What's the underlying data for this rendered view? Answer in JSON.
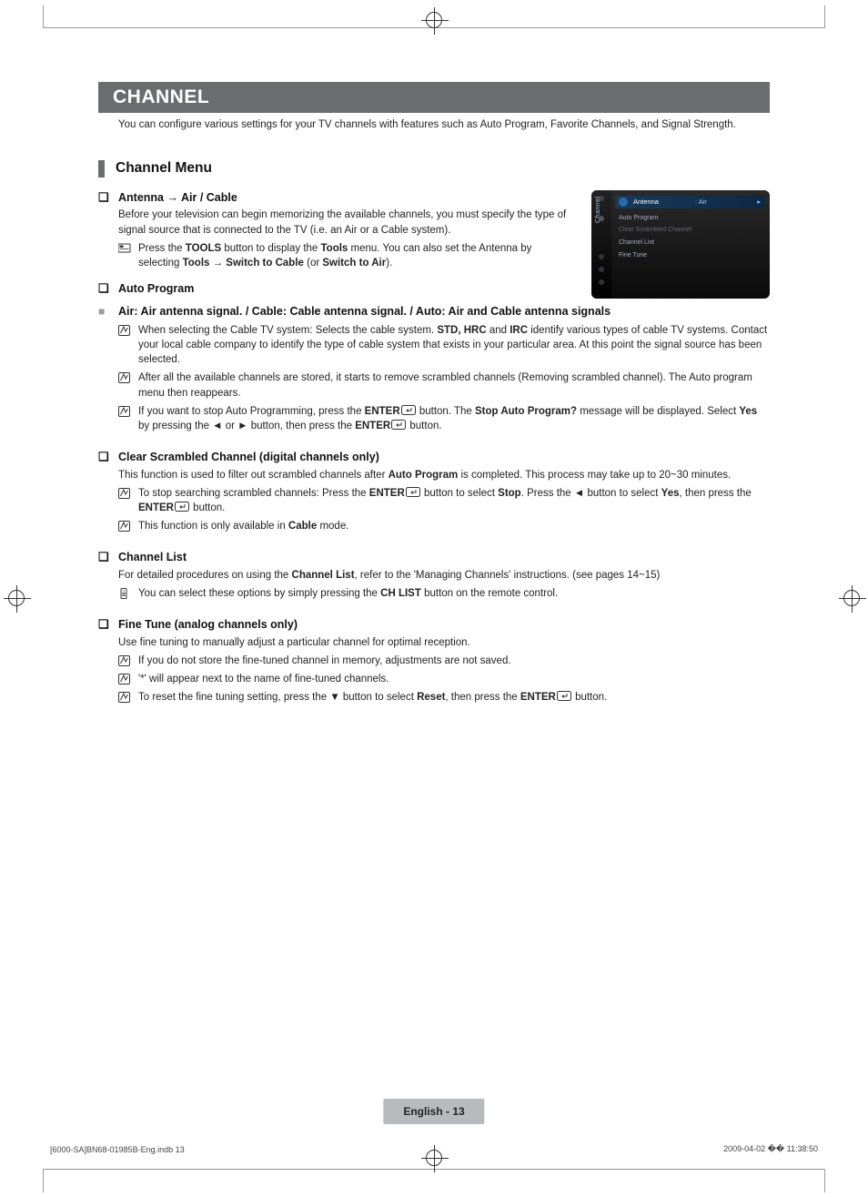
{
  "title": "CHANNEL",
  "intro": "You can configure various settings for your TV channels with features such as Auto Program, Favorite Channels, and Signal Strength.",
  "h2": "Channel Menu",
  "antenna": {
    "head_pre": "Antenna → ",
    "head_b": "Air / Cable",
    "body": "Before your television can begin memorizing the available channels, you must specify the type of signal source that is connected to the TV (i.e. an Air or a Cable system).",
    "tool_pre": "Press the ",
    "tool_b1": "TOOLS",
    "tool_mid": " button to display the ",
    "tool_b2": "Tools",
    "tool_mid2": " menu. You can also set the Antenna by selecting ",
    "tool_b3": "Tools → Switch to Cable",
    "tool_mid3": " (or ",
    "tool_b4": "Switch to Air",
    "tool_end": ")."
  },
  "autoprog": {
    "head": "Auto Program",
    "sig": "Air: Air antenna signal. / Cable: Cable antenna signal. / Auto: Air and Cable antenna signals",
    "n1_pre": "When selecting the Cable TV system: Selects the cable system. ",
    "n1_b1": "STD, HRC",
    "n1_mid": " and ",
    "n1_b2": "IRC",
    "n1_post": " identify various types of cable TV systems. Contact your local cable company to identify the type of cable system that exists in your particular area. At this point the signal source has been selected.",
    "n2": "After all the available channels are stored, it starts to remove scrambled channels (Removing scrambled channel). The Auto program menu then reappears.",
    "n3_pre": "If you want to stop Auto Programming, press the ",
    "n3_b1": "ENTER",
    "n3_mid": " button. The ",
    "n3_b2": "Stop Auto Program?",
    "n3_mid2": " message will be displayed. Select ",
    "n3_b3": "Yes",
    "n3_mid3": " by pressing the ◄ or ► button, then press the ",
    "n3_b4": "ENTER",
    "n3_end": " button."
  },
  "clear": {
    "head": "Clear Scrambled Channel (digital channels only)",
    "body_pre": "This function is used to filter out scrambled channels after ",
    "body_b": "Auto Program",
    "body_post": " is completed. This process may take up to 20~30 minutes.",
    "n1_pre": "To stop searching scrambled channels: Press the ",
    "n1_b1": "ENTER",
    "n1_mid": " button to select ",
    "n1_b2": "Stop",
    "n1_mid2": ". Press the ◄ button to select ",
    "n1_b3": "Yes",
    "n1_mid3": ", then press the ",
    "n1_b4": "ENTER",
    "n1_end": " button.",
    "n2_pre": "This function is only available in ",
    "n2_b": "Cable",
    "n2_post": " mode."
  },
  "chlist": {
    "head": "Channel List",
    "body_pre": "For detailed procedures on using the ",
    "body_b": "Channel List",
    "body_post": ", refer to the 'Managing Channels' instructions. (see pages 14~15)",
    "r_pre": "You can select these options by simply pressing the ",
    "r_b": "CH LIST",
    "r_post": " button on the remote control."
  },
  "fine": {
    "head": "Fine Tune (analog channels only)",
    "body": "Use fine tuning to manually adjust a particular channel for optimal reception.",
    "n1": "If you do not store the fine-tuned channel in memory, adjustments are not saved.",
    "n2": "'*' will appear next to the name of fine-tuned channels.",
    "n3_pre": "To reset the fine tuning setting, press the ▼ button to select ",
    "n3_b1": "Reset",
    "n3_mid": ", then press the ",
    "n3_b2": "ENTER",
    "n3_end": " button."
  },
  "osd": {
    "side": "Channel",
    "antenna": "Antenna",
    "antenna_val": ": Air",
    "items": [
      "Auto Program",
      "Clear Scrambled Channel",
      "Channel List",
      "Fine Tune"
    ]
  },
  "pagelabel": "English - 13",
  "footer_left": "[6000-SA]BN68-01985B-Eng.indb   13",
  "footer_right": "2009-04-02   �� 11:38:50"
}
